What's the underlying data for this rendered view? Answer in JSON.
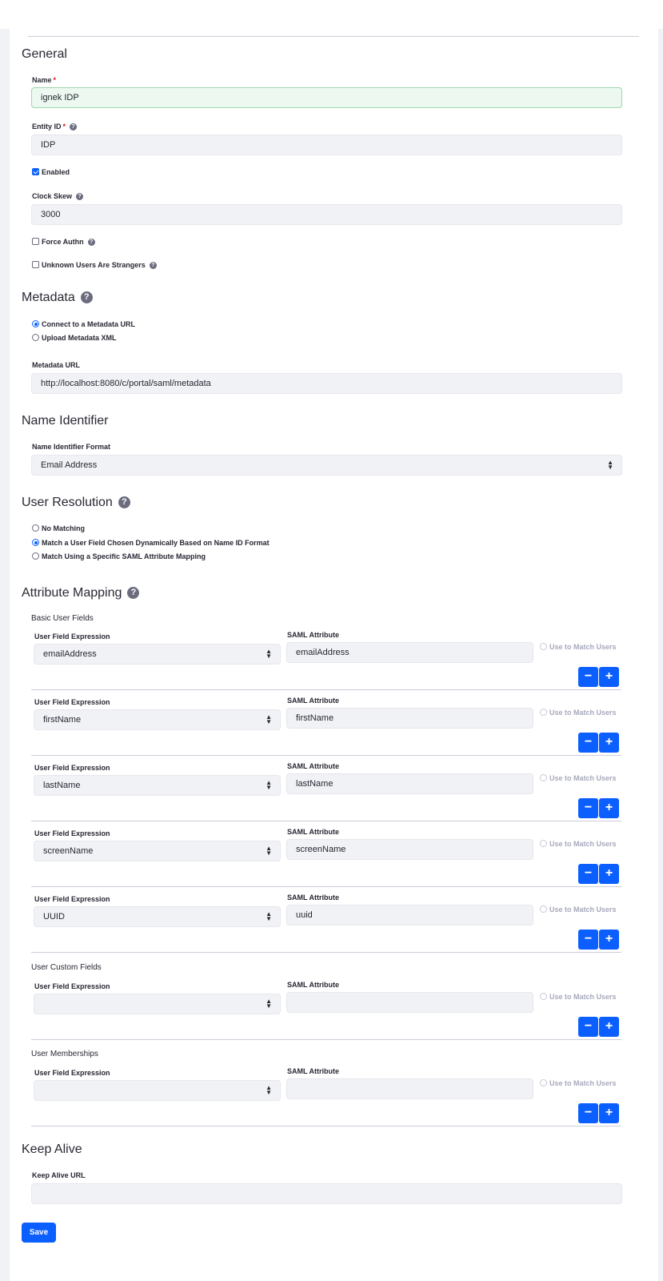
{
  "general": {
    "title": "General",
    "name_label": "Name",
    "required_mark": "*",
    "name_value": "ignek IDP",
    "entity_id_label": "Entity ID",
    "entity_id_value": "IDP",
    "enabled_label": "Enabled",
    "enabled_checked": true,
    "clock_skew_label": "Clock Skew",
    "clock_skew_value": "3000",
    "force_authn_label": "Force Authn",
    "force_authn_checked": false,
    "unknown_users_label": "Unknown Users Are Strangers",
    "unknown_users_checked": false
  },
  "help_glyph": "?",
  "metadata": {
    "title": "Metadata",
    "option_url": "Connect to a Metadata URL",
    "option_xml": "Upload Metadata XML",
    "selected": "url",
    "url_label": "Metadata URL",
    "url_value": "http://localhost:8080/c/portal/saml/metadata"
  },
  "name_identifier": {
    "title": "Name Identifier",
    "format_label": "Name Identifier Format",
    "format_value": "Email Address"
  },
  "user_resolution": {
    "title": "User Resolution",
    "options": [
      "No Matching",
      "Match a User Field Chosen Dynamically Based on Name ID Format",
      "Match Using a Specific SAML Attribute Mapping"
    ],
    "selected_index": 1
  },
  "attribute_mapping": {
    "title": "Attribute Mapping",
    "field_expression_label": "User Field Expression",
    "saml_attribute_label": "SAML Attribute",
    "match_users_label": "Use to Match Users",
    "minus_label": "−",
    "plus_label": "+",
    "basic_title": "Basic User Fields",
    "basic_rows": [
      {
        "expression": "emailAddress",
        "attribute": "emailAddress"
      },
      {
        "expression": "firstName",
        "attribute": "firstName"
      },
      {
        "expression": "lastName",
        "attribute": "lastName"
      },
      {
        "expression": "screenName",
        "attribute": "screenName"
      },
      {
        "expression": "UUID",
        "attribute": "uuid"
      }
    ],
    "custom_title": "User Custom Fields",
    "custom_rows": [
      {
        "expression": "",
        "attribute": ""
      }
    ],
    "memberships_title": "User Memberships",
    "membership_rows": [
      {
        "expression": "",
        "attribute": ""
      }
    ]
  },
  "keep_alive": {
    "title": "Keep Alive",
    "url_label": "Keep Alive URL",
    "url_value": ""
  },
  "save_label": "Save",
  "colors": {
    "primary": "#0b5fff",
    "field_bg": "#f1f2f5",
    "focus_bg": "#edf9f0",
    "required": "#da1414"
  }
}
